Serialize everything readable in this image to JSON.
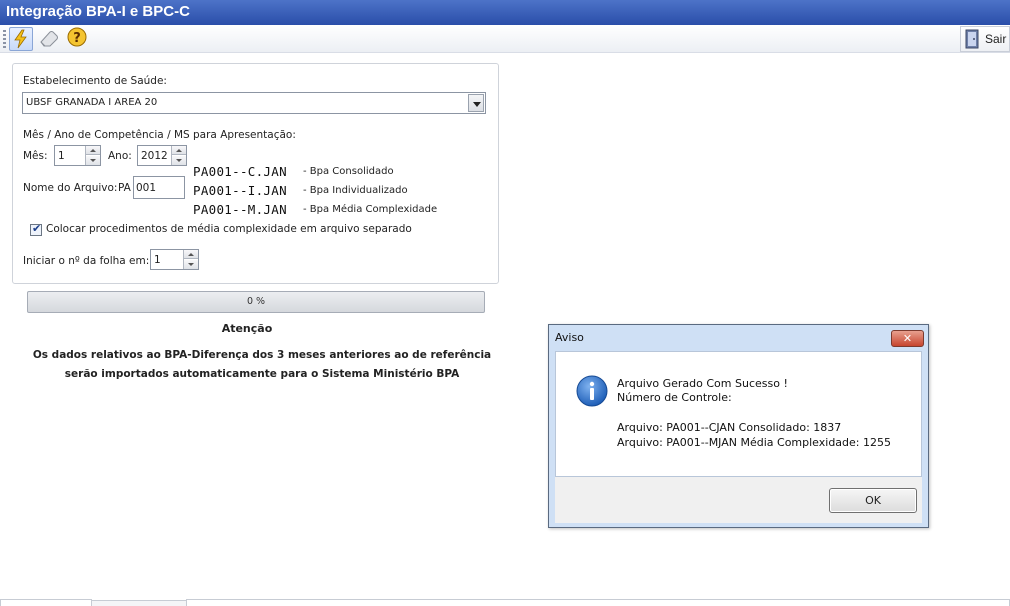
{
  "window": {
    "title": "Integração BPA-I e BPC-C"
  },
  "toolbar": {
    "buttons": [
      {
        "icon": "lightning-icon",
        "name": "run"
      },
      {
        "icon": "eraser-icon",
        "name": "clear"
      },
      {
        "icon": "help-icon",
        "name": "help"
      }
    ],
    "exit_label": "Sair"
  },
  "form": {
    "establishment_label": "Estabelecimento de Saúde:",
    "establishment_value": "UBSF GRANADA I AREA 20",
    "competence_label": "Mês / Ano de Competência / MS  para Apresentação:",
    "month_label": "Mês:",
    "month_value": "1",
    "year_label": "Ano:",
    "year_value": "2012",
    "filename_label": "Nome do Arquivo:",
    "filename_prefix": "PA",
    "filename_value": "001",
    "files": [
      {
        "name": "PA001--C.JAN",
        "desc": "- Bpa Consolidado"
      },
      {
        "name": "PA001--I.JAN",
        "desc": "- Bpa Individualizado"
      },
      {
        "name": "PA001--M.JAN",
        "desc": "- Bpa Média Complexidade"
      }
    ],
    "separate_checkbox_label": "Colocar procedimentos de média complexidade em arquivo separado",
    "separate_checked": true,
    "sheet_label": "Iniciar o nº da folha em:",
    "sheet_value": "1"
  },
  "progress": {
    "value": 0,
    "label": "0 %"
  },
  "notice": {
    "title": "Atenção",
    "line1": "Os dados relativos ao BPA-Diferença dos 3 meses anteriores ao de referência",
    "line2": "serão importados automaticamente para o Sistema Ministério BPA"
  },
  "dialog": {
    "title": "Aviso",
    "close_label": "✕",
    "line1": "Arquivo Gerado Com Sucesso !",
    "line2": "Número de Controle:",
    "line3": "Arquivo: PA001--CJAN Consolidado: 1837",
    "line4": "Arquivo: PA001--MJAN Média Complexidade: 1255",
    "ok_label": "OK"
  },
  "colors": {
    "titlebar": "#2a4ea9",
    "dialog_frame": "#cfe0f5",
    "close_button": "#c7452e",
    "info_icon": "#1f5fb8"
  }
}
